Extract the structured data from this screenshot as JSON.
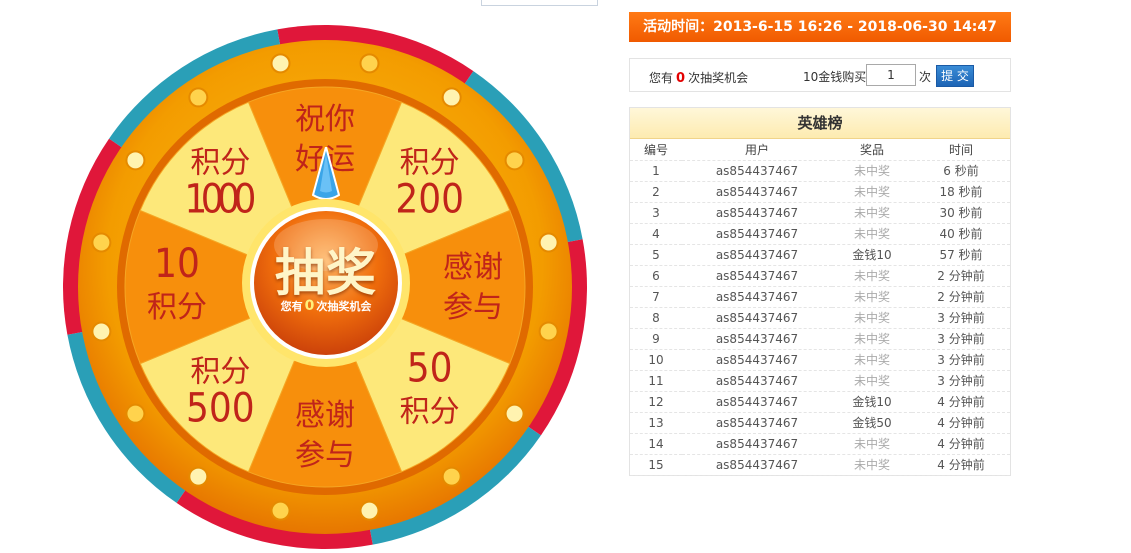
{
  "wheel": {
    "segments": [
      {
        "lines": [
          "祝你",
          "好运"
        ],
        "style": "text"
      },
      {
        "lines": [
          "积分",
          "200"
        ],
        "style": "points-top"
      },
      {
        "lines": [
          "感谢",
          "参与"
        ],
        "style": "text"
      },
      {
        "lines": [
          "50",
          "积分"
        ],
        "style": "points-bottom"
      },
      {
        "lines": [
          "感谢",
          "参与"
        ],
        "style": "text"
      },
      {
        "lines": [
          "积分",
          "500"
        ],
        "style": "points-top"
      },
      {
        "lines": [
          "10",
          "积分"
        ],
        "style": "points-bottom"
      },
      {
        "lines": [
          "积分",
          "1000"
        ],
        "style": "points-top"
      }
    ],
    "center_title": "抽奖",
    "center_sub_prefix": "您有",
    "center_sub_count": "0",
    "center_sub_suffix": "次抽奖机会",
    "colors": {
      "rim_red": "#e0173a",
      "rim_teal": "#2a9fb7",
      "outer_orange": "#f08a00",
      "seg_light": "#fde87a",
      "seg_dark": "#f78f0c",
      "text_red": "#c0241a"
    },
    "pointer_icon": "triangle-pointer-icon"
  },
  "activity": {
    "label": "活动时间：2013-6-15 16:26 - 2018-06-30 14:47"
  },
  "buy": {
    "chances_prefix": "您有",
    "chances_count": "0",
    "chances_suffix": "次抽奖机会",
    "buy_label": "10金钱购买",
    "quantity": "1",
    "unit": "次",
    "submit": "提 交"
  },
  "leaderboard": {
    "title": "英雄榜",
    "headers": [
      "编号",
      "用户",
      "奖品",
      "时间"
    ],
    "rows": [
      {
        "id": "1",
        "user": "as854437467",
        "prize": "未中奖",
        "won": false,
        "time": "6 秒前"
      },
      {
        "id": "2",
        "user": "as854437467",
        "prize": "未中奖",
        "won": false,
        "time": "18 秒前"
      },
      {
        "id": "3",
        "user": "as854437467",
        "prize": "未中奖",
        "won": false,
        "time": "30 秒前"
      },
      {
        "id": "4",
        "user": "as854437467",
        "prize": "未中奖",
        "won": false,
        "time": "40 秒前"
      },
      {
        "id": "5",
        "user": "as854437467",
        "prize": "金钱10",
        "won": true,
        "time": "57 秒前"
      },
      {
        "id": "6",
        "user": "as854437467",
        "prize": "未中奖",
        "won": false,
        "time": "2 分钟前"
      },
      {
        "id": "7",
        "user": "as854437467",
        "prize": "未中奖",
        "won": false,
        "time": "2 分钟前"
      },
      {
        "id": "8",
        "user": "as854437467",
        "prize": "未中奖",
        "won": false,
        "time": "3 分钟前"
      },
      {
        "id": "9",
        "user": "as854437467",
        "prize": "未中奖",
        "won": false,
        "time": "3 分钟前"
      },
      {
        "id": "10",
        "user": "as854437467",
        "prize": "未中奖",
        "won": false,
        "time": "3 分钟前"
      },
      {
        "id": "11",
        "user": "as854437467",
        "prize": "未中奖",
        "won": false,
        "time": "3 分钟前"
      },
      {
        "id": "12",
        "user": "as854437467",
        "prize": "金钱10",
        "won": true,
        "time": "4 分钟前"
      },
      {
        "id": "13",
        "user": "as854437467",
        "prize": "金钱50",
        "won": true,
        "time": "4 分钟前"
      },
      {
        "id": "14",
        "user": "as854437467",
        "prize": "未中奖",
        "won": false,
        "time": "4 分钟前"
      },
      {
        "id": "15",
        "user": "as854437467",
        "prize": "未中奖",
        "won": false,
        "time": "4 分钟前"
      }
    ]
  }
}
